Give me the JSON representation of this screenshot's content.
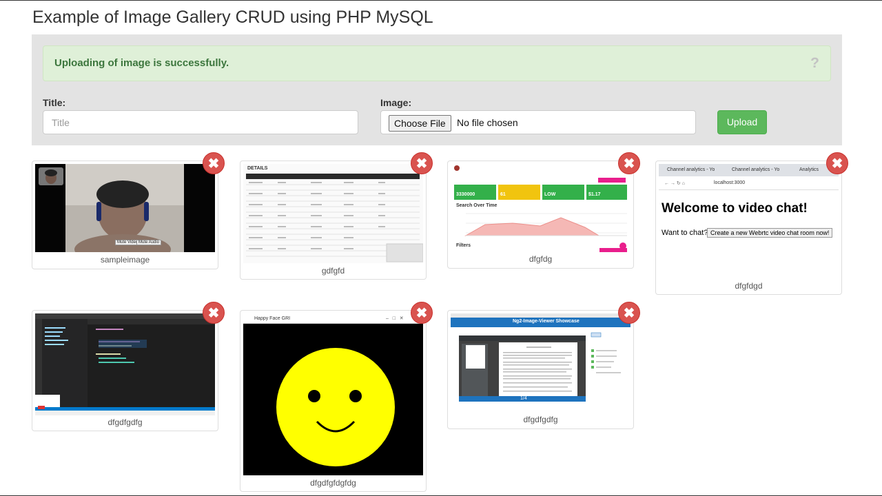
{
  "page": {
    "title": "Example of Image Gallery CRUD using PHP MySQL"
  },
  "alert": {
    "message": "Uploading of image is successfully.",
    "close_symbol": "?"
  },
  "form": {
    "title_label": "Title:",
    "title_placeholder": "Title",
    "title_value": "",
    "image_label": "Image:",
    "choose_file_label": "Choose File",
    "file_status": "No file chosen",
    "upload_label": "Upload"
  },
  "gallery": {
    "delete_symbol": "✖",
    "items": [
      {
        "caption": "sampleimage",
        "thumbnail": "webcam-video-call",
        "overlay_buttons": [
          "Mute Video",
          "Mute Audio"
        ]
      },
      {
        "caption": "gdfgfd",
        "thumbnail": "data-table-screenshot",
        "table_title": "DETAILS"
      },
      {
        "caption": "dfgfdg",
        "thumbnail": "analytics-dashboard",
        "stat_values": [
          "3330000",
          "61",
          "LOW",
          "$1.17"
        ],
        "section_title": "Search Over Time",
        "filters_label": "Filters"
      },
      {
        "caption": "dfgfdgd",
        "thumbnail": "video-chat-browser",
        "tabs": [
          "Channel analytics - Yo",
          "Channel analytics - Yo",
          "Analytics"
        ],
        "url": "localhost:3000",
        "heading": "Welcome to video chat!",
        "prompt": "Want to chat?",
        "button": "Create a new Webrtc video chat room now!"
      },
      {
        "caption": "dfgdfgdfg",
        "thumbnail": "code-editor"
      },
      {
        "caption": "dfgdfgfdgfdg",
        "thumbnail": "happy-face-window",
        "window_title": "Happy Face GRI"
      },
      {
        "caption": "dfgdfgdfg",
        "thumbnail": "pdf-viewer",
        "banner_title": "Ng2-Image-Viewer Showcase",
        "page_indicator": "1/4"
      }
    ]
  },
  "colors": {
    "alert_bg": "#dff0d8",
    "alert_text": "#3c763d",
    "upload_green": "#5cb85c",
    "delete_red": "#d9534f",
    "well_bg": "#e3e3e3"
  }
}
